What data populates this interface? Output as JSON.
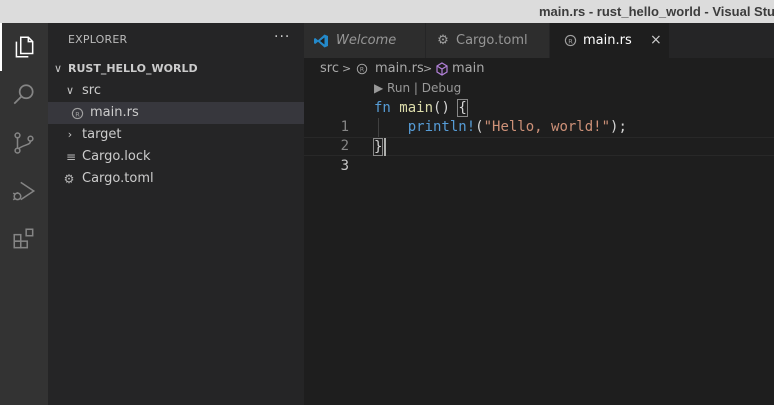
{
  "window": {
    "title": "main.rs - rust_hello_world - Visual Studio Code"
  },
  "activity_bar": [
    {
      "name": "explorer-icon",
      "active": true
    },
    {
      "name": "search-icon",
      "active": false
    },
    {
      "name": "source-control-icon",
      "active": false
    },
    {
      "name": "run-debug-icon",
      "active": false
    },
    {
      "name": "extensions-icon",
      "active": false
    }
  ],
  "explorer": {
    "title": "EXPLORER",
    "more": "···",
    "root": "RUST_HELLO_WORLD",
    "items": [
      {
        "label": "src",
        "icon": "chevron-down-icon",
        "kind": "folder",
        "expanded": true
      },
      {
        "label": "main.rs",
        "icon": "rust-file-icon",
        "kind": "file",
        "selected": true
      },
      {
        "label": "target",
        "icon": "chevron-right-icon",
        "kind": "folder",
        "expanded": false
      },
      {
        "label": "Cargo.lock",
        "icon": "lines-file-icon",
        "kind": "file"
      },
      {
        "label": "Cargo.toml",
        "icon": "gear-icon",
        "kind": "file"
      }
    ]
  },
  "tabs": [
    {
      "label": "Welcome",
      "icon": "vscode-logo-icon",
      "italic": true,
      "active": false
    },
    {
      "label": "Cargo.toml",
      "icon": "gear-icon",
      "active": false
    },
    {
      "label": "main.rs",
      "icon": "rust-file-icon",
      "active": true,
      "close": "×"
    }
  ],
  "breadcrumb": {
    "parts": [
      "src",
      ">",
      "main.rs",
      ">",
      "main"
    ]
  },
  "editor": {
    "codelens": "▶ Run | Debug",
    "line_numbers": [
      "1",
      "2",
      "3"
    ],
    "lines": [
      {
        "tokens": [
          {
            "t": "fn",
            "c": "kw"
          },
          {
            "t": " ",
            "c": "pun"
          },
          {
            "t": "main",
            "c": "fn"
          },
          {
            "t": "() ",
            "c": "pun"
          },
          {
            "t": "{",
            "c": "pun brk"
          }
        ]
      },
      {
        "tokens": [
          {
            "t": "    ",
            "c": "pun"
          },
          {
            "t": "println!",
            "c": "mac"
          },
          {
            "t": "(",
            "c": "pun"
          },
          {
            "t": "\"Hello, world!\"",
            "c": "str"
          },
          {
            "t": ");",
            "c": "pun"
          }
        ]
      },
      {
        "tokens": [
          {
            "t": "}",
            "c": "pun brk"
          }
        ]
      }
    ],
    "current_line": 3
  },
  "colors": {
    "accent": "#007acc",
    "keyword": "#569cd6",
    "function": "#dcdcaa",
    "string": "#ce9178"
  }
}
